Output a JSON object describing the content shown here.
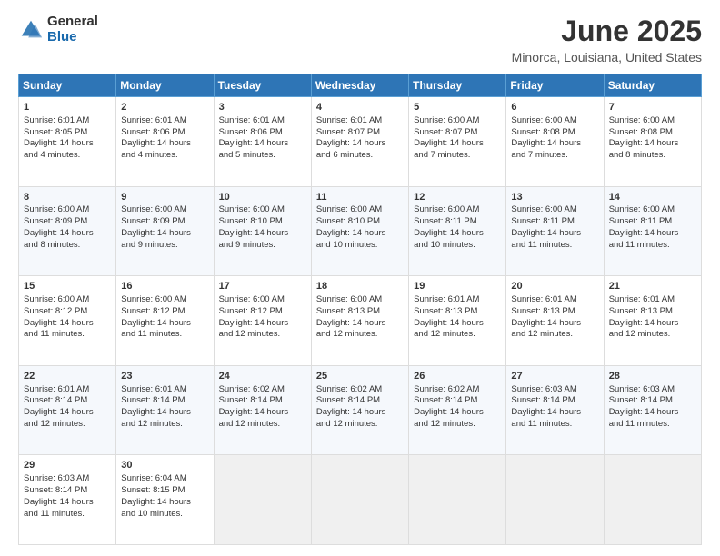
{
  "logo": {
    "general": "General",
    "blue": "Blue"
  },
  "header": {
    "month": "June 2025",
    "location": "Minorca, Louisiana, United States"
  },
  "weekdays": [
    "Sunday",
    "Monday",
    "Tuesday",
    "Wednesday",
    "Thursday",
    "Friday",
    "Saturday"
  ],
  "weeks": [
    [
      {
        "day": "1",
        "lines": [
          "Sunrise: 6:01 AM",
          "Sunset: 8:05 PM",
          "Daylight: 14 hours",
          "and 4 minutes."
        ]
      },
      {
        "day": "2",
        "lines": [
          "Sunrise: 6:01 AM",
          "Sunset: 8:06 PM",
          "Daylight: 14 hours",
          "and 4 minutes."
        ]
      },
      {
        "day": "3",
        "lines": [
          "Sunrise: 6:01 AM",
          "Sunset: 8:06 PM",
          "Daylight: 14 hours",
          "and 5 minutes."
        ]
      },
      {
        "day": "4",
        "lines": [
          "Sunrise: 6:01 AM",
          "Sunset: 8:07 PM",
          "Daylight: 14 hours",
          "and 6 minutes."
        ]
      },
      {
        "day": "5",
        "lines": [
          "Sunrise: 6:00 AM",
          "Sunset: 8:07 PM",
          "Daylight: 14 hours",
          "and 7 minutes."
        ]
      },
      {
        "day": "6",
        "lines": [
          "Sunrise: 6:00 AM",
          "Sunset: 8:08 PM",
          "Daylight: 14 hours",
          "and 7 minutes."
        ]
      },
      {
        "day": "7",
        "lines": [
          "Sunrise: 6:00 AM",
          "Sunset: 8:08 PM",
          "Daylight: 14 hours",
          "and 8 minutes."
        ]
      }
    ],
    [
      {
        "day": "8",
        "lines": [
          "Sunrise: 6:00 AM",
          "Sunset: 8:09 PM",
          "Daylight: 14 hours",
          "and 8 minutes."
        ]
      },
      {
        "day": "9",
        "lines": [
          "Sunrise: 6:00 AM",
          "Sunset: 8:09 PM",
          "Daylight: 14 hours",
          "and 9 minutes."
        ]
      },
      {
        "day": "10",
        "lines": [
          "Sunrise: 6:00 AM",
          "Sunset: 8:10 PM",
          "Daylight: 14 hours",
          "and 9 minutes."
        ]
      },
      {
        "day": "11",
        "lines": [
          "Sunrise: 6:00 AM",
          "Sunset: 8:10 PM",
          "Daylight: 14 hours",
          "and 10 minutes."
        ]
      },
      {
        "day": "12",
        "lines": [
          "Sunrise: 6:00 AM",
          "Sunset: 8:11 PM",
          "Daylight: 14 hours",
          "and 10 minutes."
        ]
      },
      {
        "day": "13",
        "lines": [
          "Sunrise: 6:00 AM",
          "Sunset: 8:11 PM",
          "Daylight: 14 hours",
          "and 11 minutes."
        ]
      },
      {
        "day": "14",
        "lines": [
          "Sunrise: 6:00 AM",
          "Sunset: 8:11 PM",
          "Daylight: 14 hours",
          "and 11 minutes."
        ]
      }
    ],
    [
      {
        "day": "15",
        "lines": [
          "Sunrise: 6:00 AM",
          "Sunset: 8:12 PM",
          "Daylight: 14 hours",
          "and 11 minutes."
        ]
      },
      {
        "day": "16",
        "lines": [
          "Sunrise: 6:00 AM",
          "Sunset: 8:12 PM",
          "Daylight: 14 hours",
          "and 11 minutes."
        ]
      },
      {
        "day": "17",
        "lines": [
          "Sunrise: 6:00 AM",
          "Sunset: 8:12 PM",
          "Daylight: 14 hours",
          "and 12 minutes."
        ]
      },
      {
        "day": "18",
        "lines": [
          "Sunrise: 6:00 AM",
          "Sunset: 8:13 PM",
          "Daylight: 14 hours",
          "and 12 minutes."
        ]
      },
      {
        "day": "19",
        "lines": [
          "Sunrise: 6:01 AM",
          "Sunset: 8:13 PM",
          "Daylight: 14 hours",
          "and 12 minutes."
        ]
      },
      {
        "day": "20",
        "lines": [
          "Sunrise: 6:01 AM",
          "Sunset: 8:13 PM",
          "Daylight: 14 hours",
          "and 12 minutes."
        ]
      },
      {
        "day": "21",
        "lines": [
          "Sunrise: 6:01 AM",
          "Sunset: 8:13 PM",
          "Daylight: 14 hours",
          "and 12 minutes."
        ]
      }
    ],
    [
      {
        "day": "22",
        "lines": [
          "Sunrise: 6:01 AM",
          "Sunset: 8:14 PM",
          "Daylight: 14 hours",
          "and 12 minutes."
        ]
      },
      {
        "day": "23",
        "lines": [
          "Sunrise: 6:01 AM",
          "Sunset: 8:14 PM",
          "Daylight: 14 hours",
          "and 12 minutes."
        ]
      },
      {
        "day": "24",
        "lines": [
          "Sunrise: 6:02 AM",
          "Sunset: 8:14 PM",
          "Daylight: 14 hours",
          "and 12 minutes."
        ]
      },
      {
        "day": "25",
        "lines": [
          "Sunrise: 6:02 AM",
          "Sunset: 8:14 PM",
          "Daylight: 14 hours",
          "and 12 minutes."
        ]
      },
      {
        "day": "26",
        "lines": [
          "Sunrise: 6:02 AM",
          "Sunset: 8:14 PM",
          "Daylight: 14 hours",
          "and 12 minutes."
        ]
      },
      {
        "day": "27",
        "lines": [
          "Sunrise: 6:03 AM",
          "Sunset: 8:14 PM",
          "Daylight: 14 hours",
          "and 11 minutes."
        ]
      },
      {
        "day": "28",
        "lines": [
          "Sunrise: 6:03 AM",
          "Sunset: 8:14 PM",
          "Daylight: 14 hours",
          "and 11 minutes."
        ]
      }
    ],
    [
      {
        "day": "29",
        "lines": [
          "Sunrise: 6:03 AM",
          "Sunset: 8:14 PM",
          "Daylight: 14 hours",
          "and 11 minutes."
        ]
      },
      {
        "day": "30",
        "lines": [
          "Sunrise: 6:04 AM",
          "Sunset: 8:15 PM",
          "Daylight: 14 hours",
          "and 10 minutes."
        ]
      },
      {
        "day": "",
        "lines": []
      },
      {
        "day": "",
        "lines": []
      },
      {
        "day": "",
        "lines": []
      },
      {
        "day": "",
        "lines": []
      },
      {
        "day": "",
        "lines": []
      }
    ]
  ]
}
